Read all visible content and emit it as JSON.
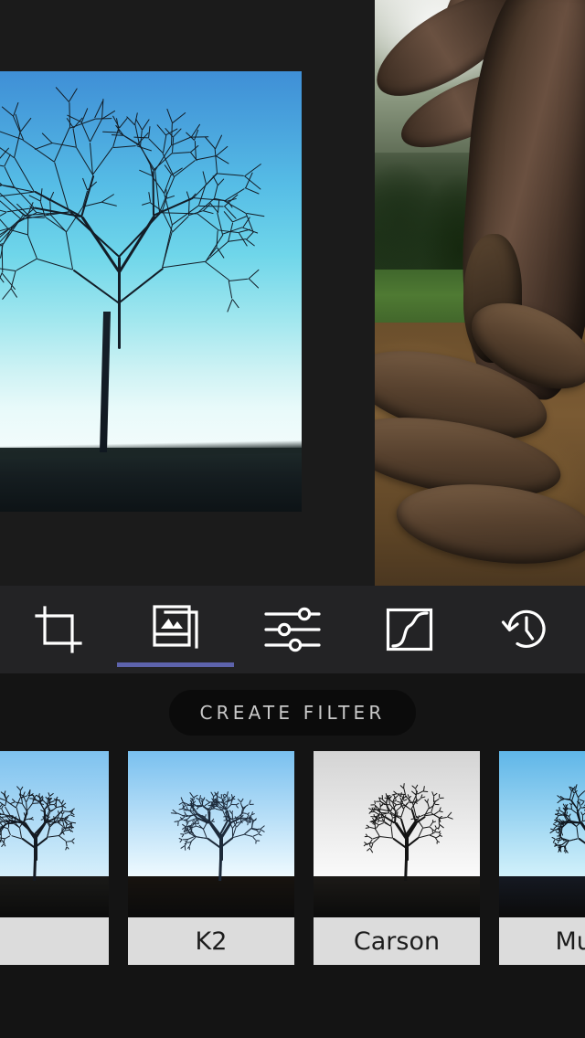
{
  "app": {
    "background_color": "#1a1a1a",
    "accent_color": "#5d63ac"
  },
  "canvas": {
    "photos": [
      {
        "name": "edited-tree-preview",
        "description": "Bare tree silhouette against cyan gradient sky with dark ground",
        "sky_top_color": "#3f8fd6",
        "sky_bottom_color": "#f4fcfc",
        "ground_color": "#151d20"
      },
      {
        "name": "tree-roots-photo",
        "description": "Large tree trunk with exposed roots, green grass and brown leaf litter",
        "grass_color": "#4f7a33",
        "ground_color": "#7a5a33",
        "trunk_color": "#4a382a"
      }
    ]
  },
  "toolbar": {
    "items": [
      {
        "icon": "crop-icon",
        "label": "Crop",
        "active": false
      },
      {
        "icon": "filters-icon",
        "label": "Filters",
        "active": true
      },
      {
        "icon": "sliders-icon",
        "label": "Adjust",
        "active": false
      },
      {
        "icon": "curves-icon",
        "label": "Curves",
        "active": false
      },
      {
        "icon": "history-icon",
        "label": "History",
        "active": false
      }
    ],
    "active_index": 1,
    "indicator_color": "#5d63ac",
    "background_color": "#232325"
  },
  "create_filter": {
    "label": "CREATE FILTER",
    "background_color": "#0b0b0b",
    "text_color": "#c9c9c9"
  },
  "filter_strip": {
    "background_color": "#141414",
    "label_background_color": "#dcdcdc",
    "label_text_color": "#1d1d1d",
    "filters": [
      {
        "name": "",
        "partial": true,
        "sky_top": "#7ec2ef",
        "sky_bottom": "#d8f0fb",
        "ground": "#1a1a18",
        "tree": "#141a22"
      },
      {
        "name": "K2",
        "partial": false,
        "sky_top": "#79c0ef",
        "sky_bottom": "#f1fbff",
        "ground": "#17130f",
        "tree": "#1d2a3a"
      },
      {
        "name": "Carson",
        "partial": false,
        "sky_top": "#d4d4d4",
        "sky_bottom": "#fbfbfb",
        "ground": "#1c1a17",
        "tree": "#141414"
      },
      {
        "name": "Muir",
        "partial": false,
        "sky_top": "#5fb6e8",
        "sky_bottom": "#d4f2fb",
        "ground": "#151922",
        "tree": "#101820"
      }
    ]
  }
}
